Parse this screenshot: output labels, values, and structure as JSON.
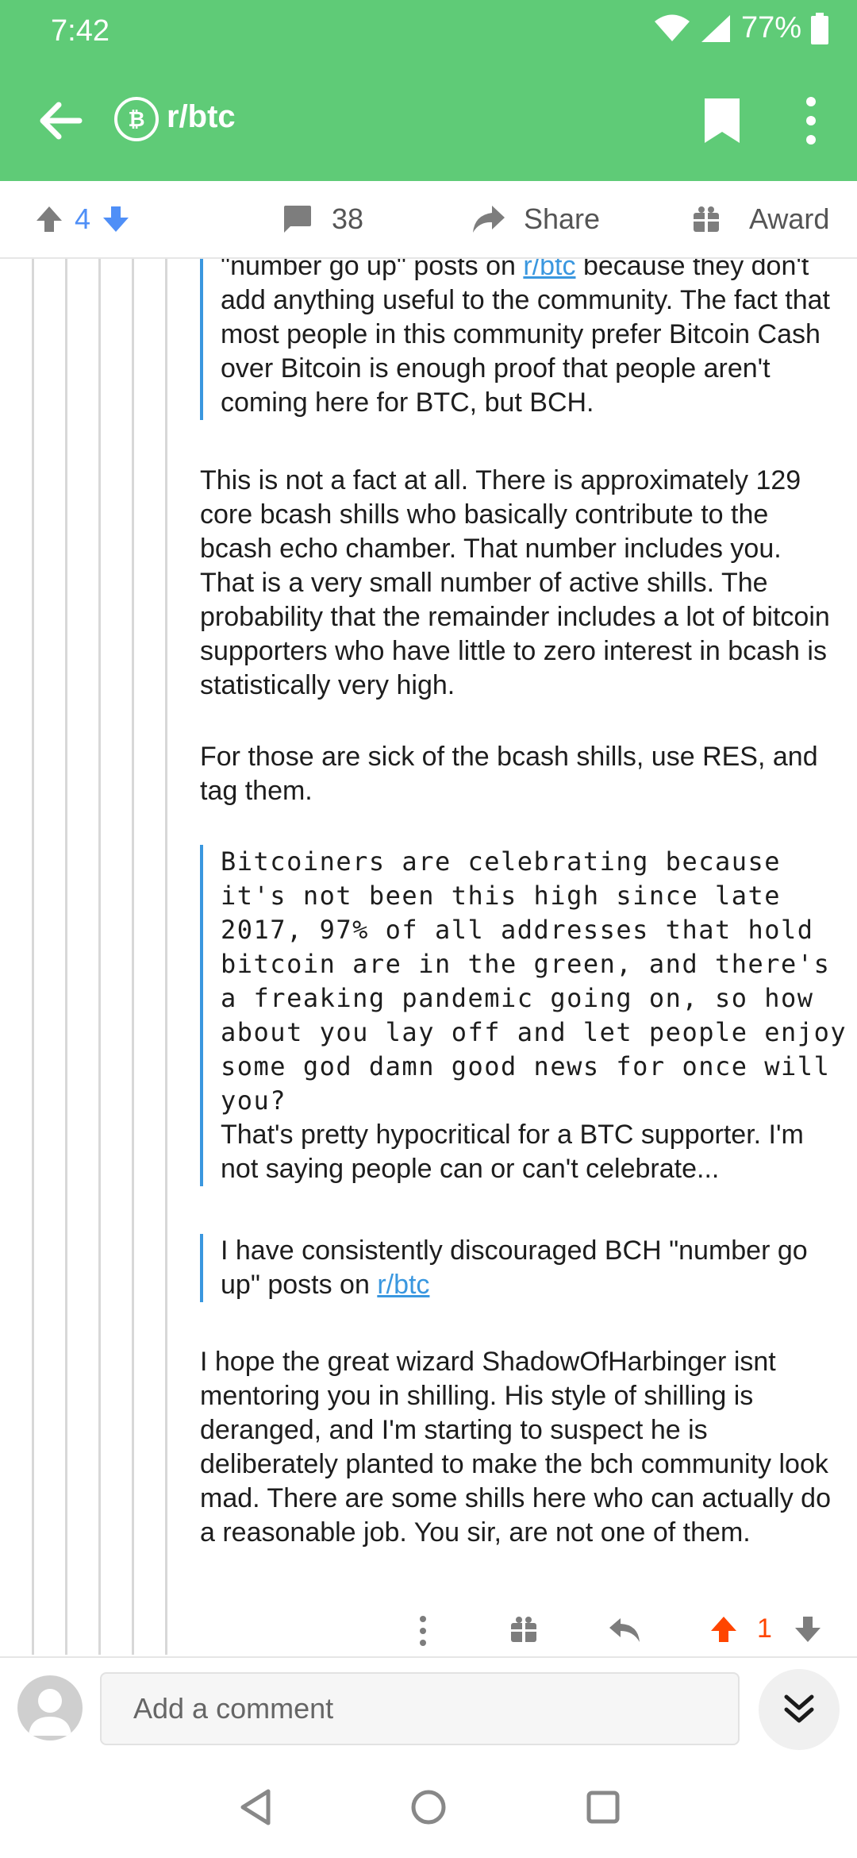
{
  "status_bar": {
    "time": "7:42",
    "battery": "77%"
  },
  "app_bar": {
    "subreddit": "r/btc",
    "sub_icon_glyph": "₿"
  },
  "action_bar": {
    "score": "4",
    "comments": "38",
    "share_label": "Share",
    "award_label": "Award",
    "score_color": "#4f8ff7"
  },
  "comment": {
    "quote1": {
      "pre": "\"number go up\" posts on ",
      "link": "r/btc",
      "post": " because they don't add anything useful to the community. The fact that most people in this community prefer Bitcoin Cash over Bitcoin is enough proof that people aren't coming here for BTC, but BCH."
    },
    "para1": "This is not a fact at all. There is approximately 129 core bcash shills who basically contribute to the bcash echo chamber. That number includes you. That is a very small number of active shills. The probability that the remainder includes a lot of bitcoin supporters who have little to zero interest in bcash is statistically very high.",
    "para2": "For those are sick of the bcash shills, use RES, and tag them.",
    "quote2": {
      "code": "Bitcoiners are celebrating because it's not been this high since late 2017, 97% of all addresses that hold bitcoin are in the green, and there's a freaking pandemic going on, so how about you lay off and let people enjoy some god damn good news for once will you?",
      "text": "That's pretty hypocritical for a BTC supporter. I'm not saying people can or can't celebrate..."
    },
    "quote3": {
      "pre": "I have consistently discouraged BCH \"number go up\" posts on ",
      "link": "r/btc"
    },
    "para3": "I hope the great wizard ShadowOfHarbinger isnt mentoring you in shilling. His style of shilling is deranged, and I'm starting to suspect he is deliberately planted to make the bch community look mad. There are some shills here who can actually do a reasonable job. You sir, are not one of them.",
    "vote_count": "1",
    "vote_color": "#ff4500"
  },
  "composer": {
    "placeholder": "Add a comment"
  },
  "colors": {
    "brand_green": "#5fcb77",
    "link_blue": "#3a97df"
  }
}
